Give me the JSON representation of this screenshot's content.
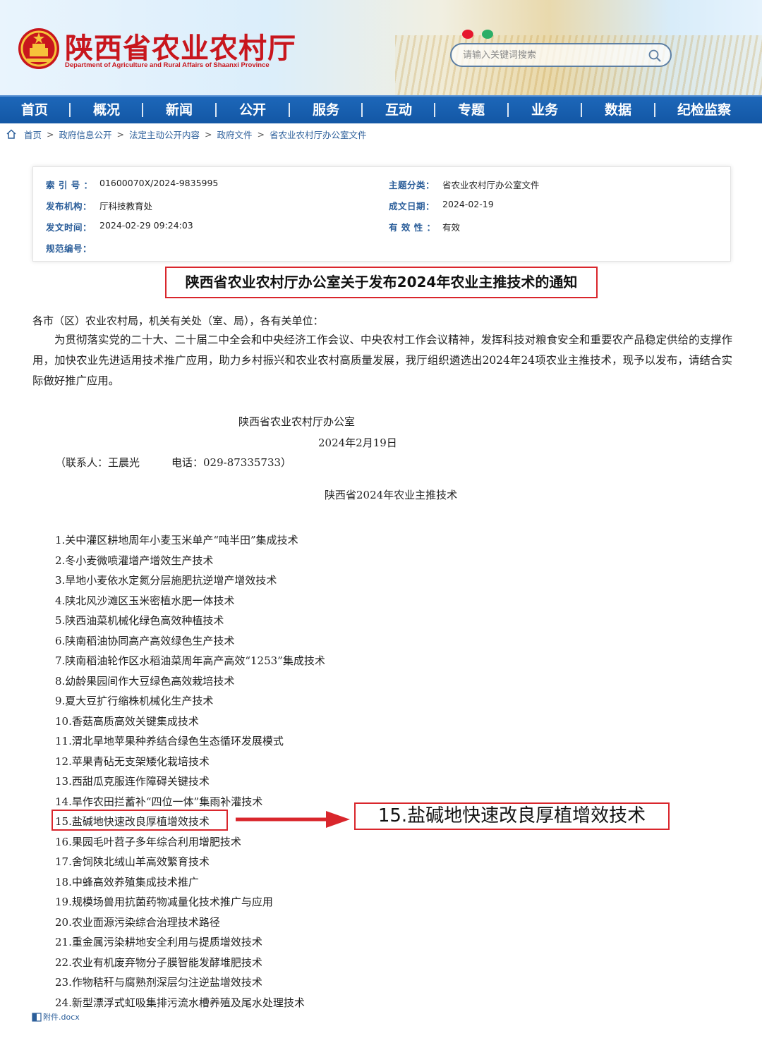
{
  "header": {
    "site_title": "陕西省农业农村厅",
    "site_subtitle": "Department of Agriculture and Rural Affairs of Shaanxi Province",
    "search_placeholder": "请输入关键词搜索",
    "share_icons": [
      "weibo-icon",
      "wechat-icon"
    ]
  },
  "nav": {
    "items": [
      "首页",
      "概况",
      "新闻",
      "公开",
      "服务",
      "互动",
      "专题",
      "业务",
      "数据",
      "纪检监察"
    ]
  },
  "breadcrumb": [
    "首页",
    "政府信息公开",
    "法定主动公开内容",
    "政府文件",
    "省农业农村厅办公室文件"
  ],
  "meta": {
    "index_label": "索 引 号 ：",
    "index_value": "01600070X/2024-9835995",
    "issuer_label": "发布机构：",
    "issuer_value": "厅科技教育处",
    "issue_time_label": "发文时间：",
    "issue_time_value": "2024-02-29 09:24:03",
    "code_label": "规范编号：",
    "code_value": "",
    "topic_label": "主题分类：",
    "topic_value": "省农业农村厅办公室文件",
    "date_label": "成文日期：",
    "date_value": "2024-02-19",
    "validity_label": "有 效 性 ：",
    "validity_value": "有效"
  },
  "document": {
    "title": "陕西省农业农村厅办公室关于发布2024年农业主推技术的通知",
    "salutation": "各市（区）农业农村局，机关有关处（室、局），各有关单位：",
    "paragraph": "为贯彻落实党的二十大、二十届二中全会和中央经济工作会议、中央农村工作会议精神，发挥科技对粮食安全和重要农产品稳定供给的支撑作用，加快农业先进适用技术推广应用，助力乡村振兴和农业农村高质量发展，我厅组织遴选出2024年24项农业主推技术，现予以发布，请结合实际做好推广应用。",
    "signature": "陕西省农业农村厅办公室",
    "sign_date": "2024年2月19日",
    "contact": "（联系人：王晨光　　　电话：029-87335733）",
    "list_title": "陕西省2024年农业主推技术",
    "list": [
      "1.关中灌区耕地周年小麦玉米单产“吨半田”集成技术",
      "2.冬小麦微喷灌增产增效生产技术",
      "3.旱地小麦依水定氮分层施肥抗逆增产增效技术",
      "4.陕北风沙滩区玉米密植水肥一体技术",
      "5.陕西油菜机械化绿色高效种植技术",
      "6.陕南稻油协同高产高效绿色生产技术",
      "7.陕南稻油轮作区水稻油菜周年高产高效“1253”集成技术",
      "8.幼龄果园间作大豆绿色高效栽培技术",
      "9.夏大豆扩行缩株机械化生产技术",
      "10.香菇高质高效关键集成技术",
      "11.渭北旱地苹果种养结合绿色生态循环发展模式",
      "12.苹果青砧无支架矮化栽培技术",
      "13.西甜瓜克服连作障碍关键技术",
      "14.旱作农田拦蓄补“四位一体”集雨补灌技术",
      "15.盐碱地快速改良厚植增效技术",
      "16.果园毛叶苕子多年综合利用增肥技术",
      "17.舍饲陕北绒山羊高效繁育技术",
      "18.中蜂高效养殖集成技术推广",
      "19.规模场兽用抗菌药物减量化技术推广与应用",
      "20.农业面源污染综合治理技术路径",
      "21.重金属污染耕地安全利用与提质增效技术",
      "22.农业有机废弃物分子膜智能发酵堆肥技术",
      "23.作物秸秆与腐熟剂深层匀注逆盐增效技术",
      "24.新型漂浮式虹吸集排污流水槽养殖及尾水处理技术"
    ],
    "callout": "15.盐碱地快速改良厚植增效技术",
    "attachment": "附件.docx"
  },
  "colors": {
    "brand_red": "#c8161d",
    "nav_blue": "#1a62b3",
    "link_blue": "#2b5e9a",
    "highlight_red": "#d9262c"
  }
}
